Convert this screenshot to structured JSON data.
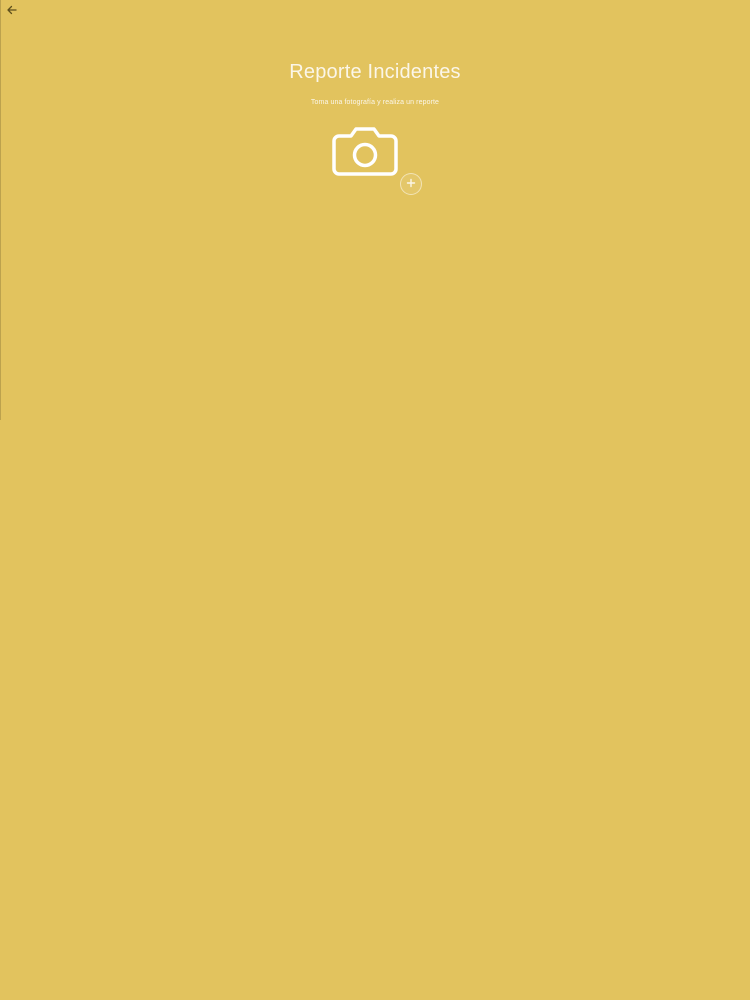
{
  "app": {
    "background_color": "#e2c35e",
    "text_color": "#fbf6e8"
  },
  "header": {
    "back_icon": "back-arrow-icon"
  },
  "main": {
    "title": "Reporte Incidentes",
    "subtitle": "Toma una fotografía y realiza un reporte",
    "camera_icon": "camera-icon",
    "add_icon": "plus-icon"
  }
}
